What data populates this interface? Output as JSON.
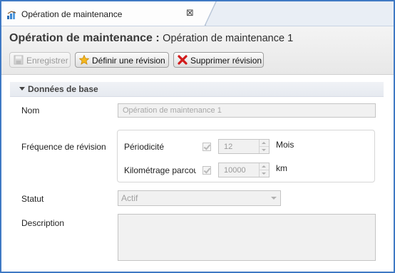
{
  "tab": {
    "title": "Opération de maintenance",
    "close": "⊠"
  },
  "header": {
    "title": "Opération de maintenance :",
    "subtitle": "Opération de maintenance 1"
  },
  "toolbar": {
    "save_label": "Enregistrer",
    "define_revision_label": "Définir une révision",
    "delete_revision_label": "Supprimer révision"
  },
  "section": {
    "title": "Données de base"
  },
  "form": {
    "name_label": "Nom",
    "name_value": "Opération de maintenance 1",
    "frequency_label": "Fréquence de révision",
    "periodicity_label": "Périodicité",
    "periodicity_value": "12",
    "periodicity_unit": "Mois",
    "periodicity_checked": true,
    "mileage_label": "Kilométrage parcou",
    "mileage_value": "10000",
    "mileage_unit": "km",
    "mileage_checked": true,
    "status_label": "Statut",
    "status_value": "Actif",
    "description_label": "Description",
    "description_value": ""
  },
  "colors": {
    "accent_border": "#3f79c4",
    "disabled_text": "#a7a7a7"
  },
  "icons": [
    "maintenance-icon",
    "save-icon",
    "star-icon",
    "delete-x-icon",
    "chevron-down-icon"
  ]
}
